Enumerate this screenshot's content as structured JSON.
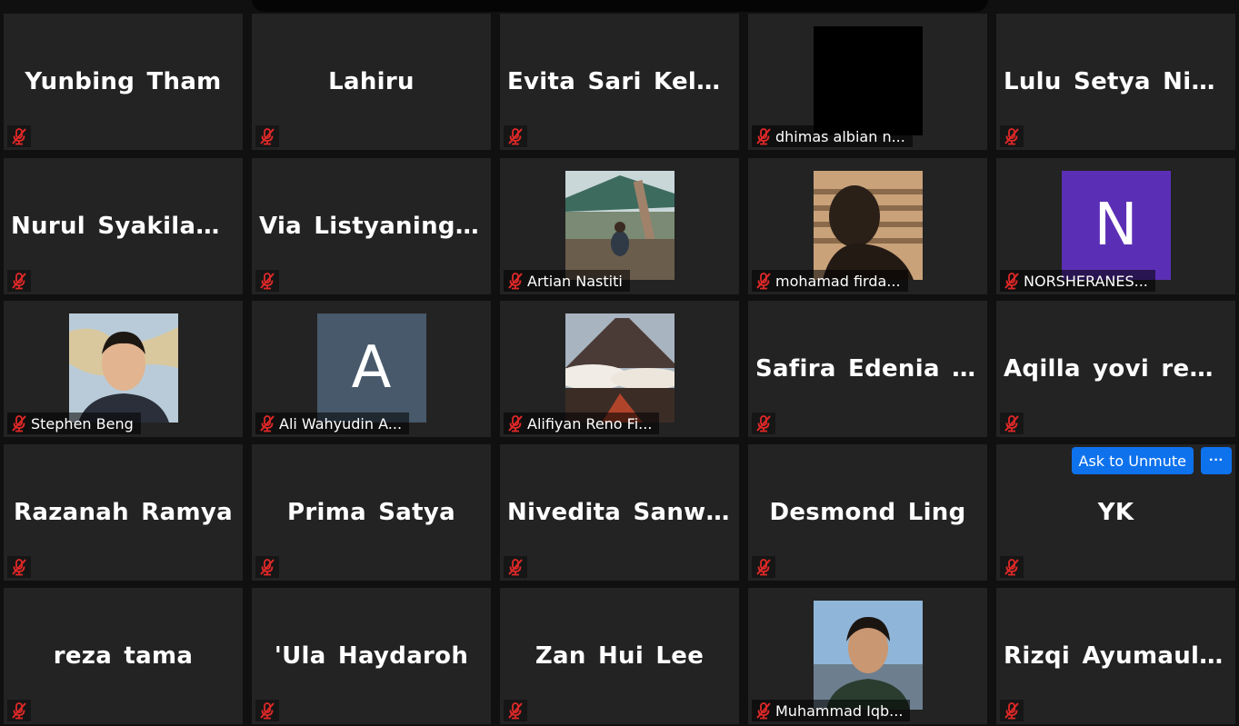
{
  "tiles": [
    {
      "name": "Yunbing Tham"
    },
    {
      "name": "Lahiru"
    },
    {
      "name": "Evita Sari Kelan..."
    },
    {
      "name": "dhimas albian n...",
      "thumb": "dark-video"
    },
    {
      "name": "Lulu Setya Ning..."
    },
    {
      "name": "Nurul Syakilah..."
    },
    {
      "name": "Via Listyaningr..."
    },
    {
      "name": "Artian Nastiti",
      "thumb": "photo-outdoor"
    },
    {
      "name": "mohamad firda...",
      "thumb": "photo-silhouette"
    },
    {
      "name": "NORSHERANES...",
      "thumb": "letter",
      "letter": "N",
      "color": "#5b2fb5"
    },
    {
      "name": "Stephen Beng",
      "thumb": "photo-portrait"
    },
    {
      "name": "Ali Wahyudin A...",
      "thumb": "letter",
      "letter": "A",
      "color": "#47596a"
    },
    {
      "name": "Alifiyan Reno Fi...",
      "thumb": "photo-volcano"
    },
    {
      "name": "Safira Edenia Sa..."
    },
    {
      "name": "Aqilla yovi rena..."
    },
    {
      "name": "Razanah Ramya"
    },
    {
      "name": "Prima Satya"
    },
    {
      "name": "Nivedita Sanwl..."
    },
    {
      "name": "Desmond Ling"
    },
    {
      "name": "YK",
      "hover": true
    },
    {
      "name": "reza tama"
    },
    {
      "name": "'Ula Haydaroh"
    },
    {
      "name": "Zan Hui Lee"
    },
    {
      "name": "Muhammad Iqb...",
      "thumb": "photo-person"
    },
    {
      "name": "Rizqi Ayumauli..."
    }
  ],
  "hover_controls": {
    "ask_label": "Ask to Unmute",
    "more_label": "···"
  },
  "colors": {
    "tile_bg": "#232323",
    "mute_red": "#e02828",
    "accent": "#0e72ed"
  },
  "icons": {
    "mute": "muted-microphone-icon"
  }
}
